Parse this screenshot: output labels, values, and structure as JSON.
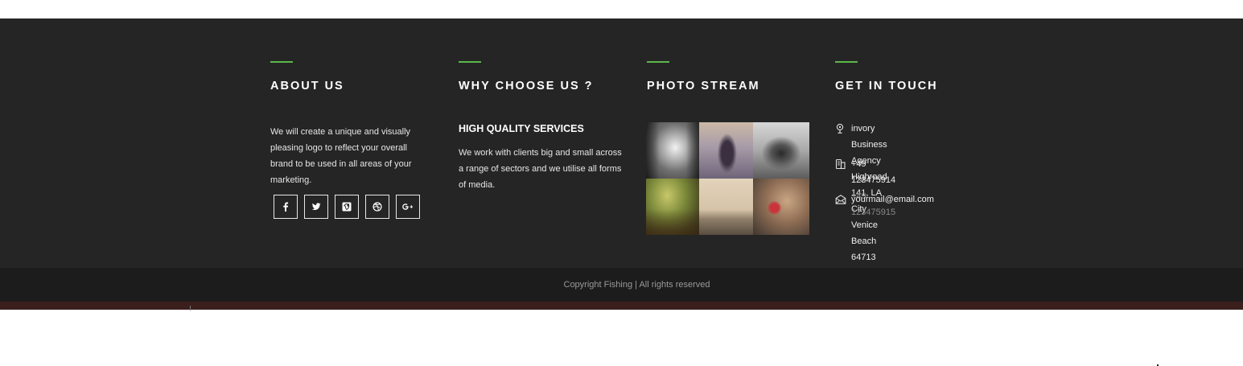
{
  "colors": {
    "accent": "#5cb84a",
    "footer_bg": "#252525",
    "bottom_bg": "#1c1c1c"
  },
  "about": {
    "heading": "ABOUT US",
    "text": "We will create a unique and visually pleasing logo to reflect your overall brand to be used in all areas of your marketing.",
    "social": [
      {
        "icon": "facebook-icon",
        "glyph": "f"
      },
      {
        "icon": "twitter-icon",
        "glyph": "twitter"
      },
      {
        "icon": "vimeo-icon",
        "glyph": "v"
      },
      {
        "icon": "dribbble-icon",
        "glyph": "dribbble"
      },
      {
        "icon": "google-plus-icon",
        "glyph": "G+"
      }
    ]
  },
  "why": {
    "heading": "WHY CHOOSE US ?",
    "subheading": "HIGH QUALITY SERVICES",
    "text": "We work with clients big and small across a range of sectors and we utilise all forms of media."
  },
  "photo_stream": {
    "heading": "PHOTO STREAM",
    "photos": [
      {
        "icon": "photo-hallway"
      },
      {
        "icon": "photo-bridge-person"
      },
      {
        "icon": "photo-binoculars-city"
      },
      {
        "icon": "photo-park-bench"
      },
      {
        "icon": "photo-city-skyline"
      },
      {
        "icon": "photo-love-locks"
      }
    ]
  },
  "contact": {
    "heading": "GET IN TOUCH",
    "address_line1": "invory Business Agency Highroad",
    "address_line2": "141, LA City Venice Beach 64713",
    "phone1": "+49 123475914",
    "phone2": "+49 123475915",
    "email": "yourmail@email.com"
  },
  "footer": {
    "copyright": "Copyright Fishing | All rights reserved"
  }
}
